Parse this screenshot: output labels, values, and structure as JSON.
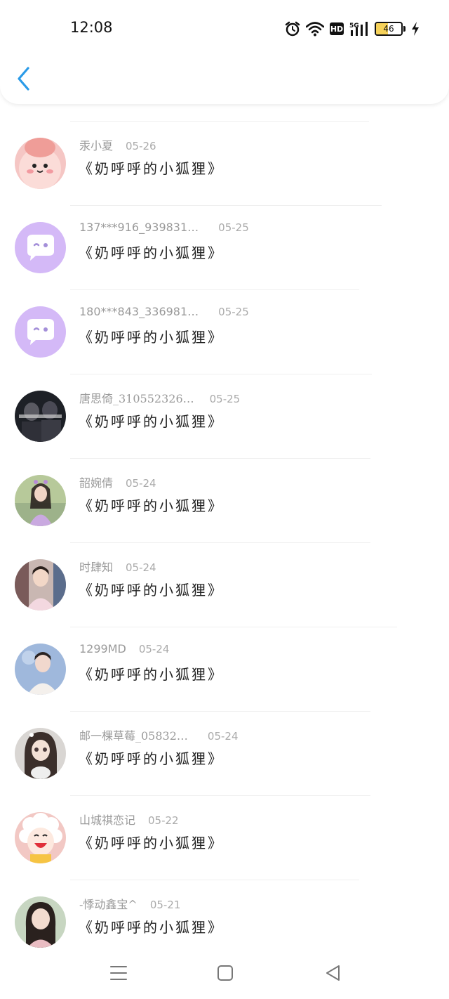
{
  "status_bar": {
    "time": "12:08",
    "hd": "HD",
    "network": "5G",
    "battery_percent": "46",
    "icons": [
      "alarm-icon",
      "wifi-icon",
      "hd-icon",
      "signal-5g-icon",
      "battery-icon",
      "charging-icon"
    ]
  },
  "header": {
    "back_icon": "chevron-left-icon",
    "accent": "#2b9be8"
  },
  "messages": [
    {
      "name": "汞小夏",
      "date": "05-26",
      "title": "《奶呼呼的小狐狸》",
      "avatar": "pink-cartoon"
    },
    {
      "name": "137***916_939831…",
      "date": "05-25",
      "title": "《奶呼呼的小狐狸》",
      "avatar": "purple-chat"
    },
    {
      "name": "180***843_336981…",
      "date": "05-25",
      "title": "《奶呼呼的小狐狸》",
      "avatar": "purple-chat"
    },
    {
      "name": "唐思倚_310552326…",
      "date": "05-25",
      "title": "《奶呼呼的小狐狸》",
      "avatar": "dark-photo"
    },
    {
      "name": "韶婉倩",
      "date": "05-24",
      "title": "《奶呼呼的小狐狸》",
      "avatar": "green-photo"
    },
    {
      "name": "时肆知",
      "date": "05-24",
      "title": "《奶呼呼的小狐狸》",
      "avatar": "pink-photo"
    },
    {
      "name": "1299MD",
      "date": "05-24",
      "title": "《奶呼呼的小狐狸》",
      "avatar": "blue-photo"
    },
    {
      "name": "邮一棵草莓_05832…",
      "date": "05-24",
      "title": "《奶呼呼的小狐狸》",
      "avatar": "doll-photo"
    },
    {
      "name": "山城祺恋记",
      "date": "05-22",
      "title": "《奶呼呼的小狐狸》",
      "avatar": "sheep-cartoon"
    },
    {
      "name": "-悸动鑫宝^",
      "date": "05-21",
      "title": "《奶呼呼的小狐狸》",
      "avatar": "girl-photo"
    }
  ],
  "nav_bar": {
    "icons": [
      "menu-icon",
      "home-square-icon",
      "back-triangle-icon"
    ]
  }
}
